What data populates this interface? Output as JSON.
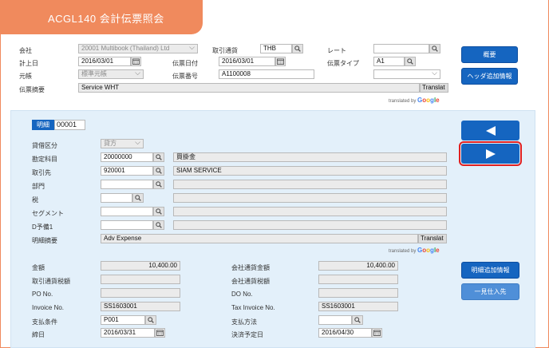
{
  "title": "ACGL140 会計伝票照会",
  "header": {
    "company_label": "会社",
    "company_value": "20001 Multibook (Thailand) Ltd",
    "currency_label": "取引通貨",
    "currency_value": "THB",
    "rate_label": "レート",
    "rate_value": "",
    "posting_date_label": "計上日",
    "posting_date_value": "2016/03/01",
    "voucher_date_label": "伝票日付",
    "voucher_date_value": "2016/03/01",
    "voucher_type_label": "伝票タイプ",
    "voucher_type_value": "A1",
    "ledger_label": "元帳",
    "ledger_value": "標準元帳",
    "voucher_no_label": "伝票番号",
    "voucher_no_value": "A1100008",
    "extra_select_value": "",
    "summary_label": "伝票摘要",
    "summary_value": "Service WHT",
    "translate_label": "Translat"
  },
  "translated_by": {
    "prefix": "translated by",
    "brand": "Google"
  },
  "side_buttons": {
    "overview": "概要",
    "header_extra": "ヘッダ追加情報"
  },
  "detail": {
    "tag": "明細",
    "line_no": "00001",
    "dc_label": "貸借区分",
    "dc_value": "貸方",
    "account_label": "勘定科目",
    "account_code": "20000000",
    "account_name": "買掛金",
    "partner_label": "取引先",
    "partner_code": "920001",
    "partner_name": "SIAM SERVICE",
    "dept_label": "部門",
    "dept_code": "",
    "dept_name": "",
    "tax_label": "税",
    "tax_code": "",
    "tax_name": "",
    "segment_label": "セグメント",
    "segment_code": "",
    "segment_name": "",
    "reserve_label": "D予備1",
    "reserve_code": "",
    "reserve_name": "",
    "desc_label": "明細摘要",
    "desc_value": "Adv Expense",
    "translate_label": "Translat"
  },
  "amounts": {
    "amount_label": "金額",
    "amount_value": "10,400.00",
    "company_amount_label": "会社通貨金額",
    "company_amount_value": "10,400.00",
    "tx_tax_label": "取引通貨税額",
    "tx_tax_value": "",
    "company_tax_label": "会社通貨税額",
    "company_tax_value": "",
    "po_label": "PO No.",
    "po_value": "",
    "do_label": "DO No.",
    "do_value": "",
    "invoice_label": "Invoice No.",
    "invoice_value": "SS1603001",
    "tax_invoice_label": "Tax Invoice No.",
    "tax_invoice_value": "SS1603001",
    "pay_terms_label": "支払条件",
    "pay_terms_value": "P001",
    "pay_method_label": "支払方法",
    "pay_method_value": "",
    "closing_label": "締日",
    "closing_value": "2016/03/31",
    "settle_label": "決済予定日",
    "settle_value": "2016/04/30"
  },
  "detail_buttons": {
    "line_extra": "明細追加情報",
    "supplier_list": "一見仕入先"
  },
  "colors": {
    "accent": "#f08a5d",
    "primary": "#1565c0",
    "panel": "#e3f0fa",
    "highlight": "#e02020"
  }
}
